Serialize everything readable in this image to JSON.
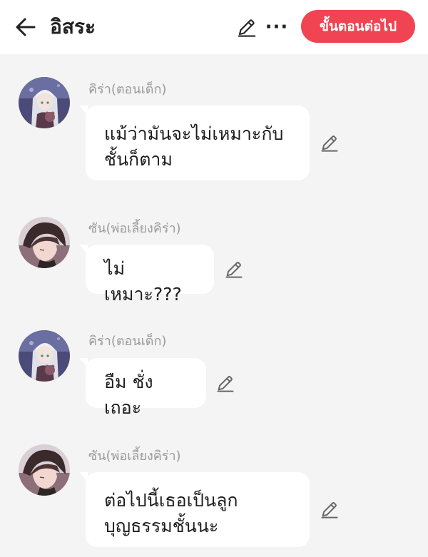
{
  "header": {
    "title": "อิสระ",
    "next_label": "ขั้นตอนต่อไป",
    "more_label": "···",
    "accent": "#f04452"
  },
  "messages": [
    {
      "sender": "คิร่า(ตอนเด็ก)",
      "text": "แม้ว่ามันจะไม่เหมาะกับ\nชั้นก็ตาม",
      "avatar": "girl-avatar"
    },
    {
      "sender": "ซัน(พ่อเลี้ยงคิร่า)",
      "text": "ไม่เหมาะ???",
      "avatar": "boy-avatar"
    },
    {
      "sender": "คิร่า(ตอนเด็ก)",
      "text": "อืม ชั่งเถอะ",
      "avatar": "girl-avatar"
    },
    {
      "sender": "ซัน(พ่อเลี้ยงคิร่า)",
      "text": "ต่อไปนี้เธอเป็นลูก\nบุญธรรมชั้นนะ",
      "avatar": "boy-avatar"
    }
  ]
}
